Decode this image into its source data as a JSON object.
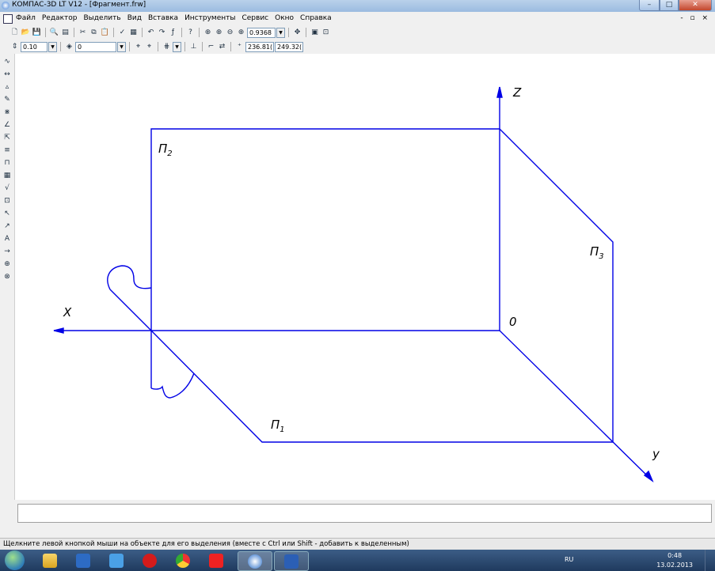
{
  "window": {
    "title": "КОМПАС-3D LT V12 - [Фрагмент.frw]",
    "min": "–",
    "max": "□",
    "close": "✕"
  },
  "menu": {
    "items": [
      "Файл",
      "Редактор",
      "Выделить",
      "Вид",
      "Вставка",
      "Инструменты",
      "Сервис",
      "Окно",
      "Справка"
    ],
    "mdi_buttons": "- ▫ ×"
  },
  "toolbar1": {
    "zoom_value": "0.9368"
  },
  "toolbar2": {
    "step_value": "0.10",
    "layer_value": "0",
    "coord_x": "236.81(",
    "coord_y": "249.32("
  },
  "drawing": {
    "axis_x": "X",
    "axis_z": "Z",
    "axis_y": "y",
    "origin": "0",
    "plane_frontal": "П",
    "plane_frontal_sub": "2",
    "plane_profile": "П",
    "plane_profile_sub": "3",
    "plane_horizontal": "П",
    "plane_horizontal_sub": "1",
    "line_color": "#0000e6"
  },
  "status": {
    "hint": "Щелкните левой кнопкой мыши на объекте для его выделения (вместе с Ctrl или Shift - добавить к выделенным)"
  },
  "taskbar": {
    "lang": "RU",
    "time": "0:48",
    "date": "13.02.2013",
    "apps": [
      "explorer-icon",
      "outlook-icon",
      "mail-icon",
      "opera-icon",
      "chrome-icon",
      "yandex-icon",
      "kompas-icon",
      "word-icon"
    ]
  }
}
